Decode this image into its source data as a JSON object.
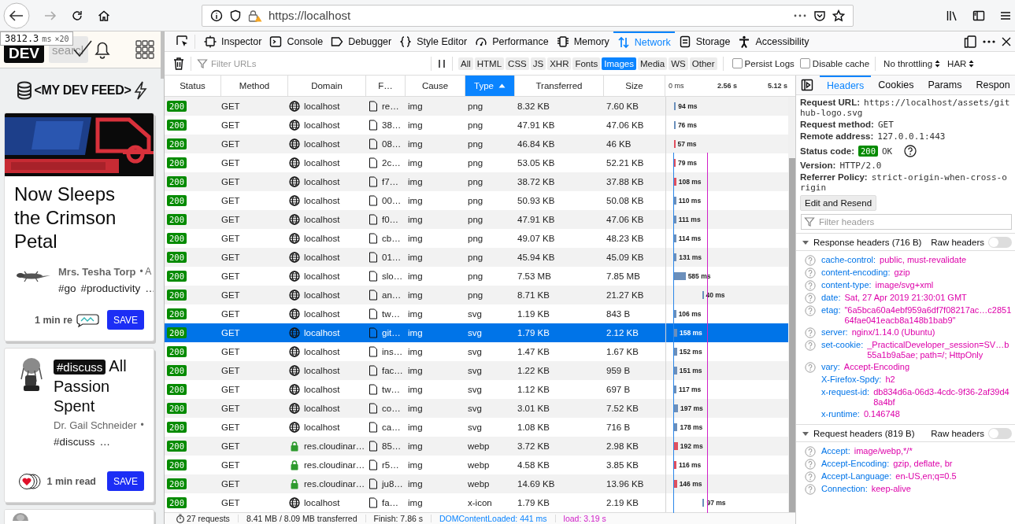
{
  "browser": {
    "url": "https://localhost"
  },
  "tooltip": {
    "value": "3812.3",
    "unit": "ms",
    "count": "×20"
  },
  "page": {
    "logo": "DEV",
    "search_placeholder": "searcl",
    "feed_title": "<MY DEV FEED>",
    "cards": [
      {
        "kind": "banner",
        "title": "Now Sleeps the Crimson Petal",
        "author": "Mrs. Tesha Torp",
        "meta": "• A",
        "tags": [
          "#go",
          "#productivity"
        ],
        "more": "…",
        "read_time": "1 min re",
        "save": "SAVE"
      },
      {
        "kind": "tagged",
        "tag": "#discuss",
        "title": "All Passion Spent",
        "author": "Dr. Gail Schneider",
        "meta": "•",
        "tags": [
          "#discuss"
        ],
        "more": "…",
        "read_time": "1 min read",
        "save": "SAVE"
      }
    ]
  },
  "devtools": {
    "tabs": [
      {
        "label": "Inspector",
        "selected": false
      },
      {
        "label": "Console",
        "selected": false
      },
      {
        "label": "Debugger",
        "selected": false
      },
      {
        "label": "Style Editor",
        "selected": false
      },
      {
        "label": "Performance",
        "selected": false
      },
      {
        "label": "Memory",
        "selected": false
      },
      {
        "label": "Network",
        "selected": true
      },
      {
        "label": "Storage",
        "selected": false
      },
      {
        "label": "Accessibility",
        "selected": false
      }
    ]
  },
  "toolbar": {
    "filter_placeholder": "Filter URLs",
    "types": [
      {
        "label": "All",
        "selected": false
      },
      {
        "label": "HTML",
        "selected": false
      },
      {
        "label": "CSS",
        "selected": false
      },
      {
        "label": "JS",
        "selected": false
      },
      {
        "label": "XHR",
        "selected": false
      },
      {
        "label": "Fonts",
        "selected": false
      },
      {
        "label": "Images",
        "selected": true
      },
      {
        "label": "Media",
        "selected": false
      },
      {
        "label": "WS",
        "selected": false
      },
      {
        "label": "Other",
        "selected": false
      }
    ],
    "persist_logs": {
      "label": "Persist Logs",
      "checked": false
    },
    "disable_cache": {
      "label": "Disable cache",
      "checked": false
    },
    "throttling": "No throttling",
    "har": "HAR"
  },
  "table": {
    "columns": [
      {
        "label": "Status",
        "sorted": false
      },
      {
        "label": "Method",
        "sorted": false
      },
      {
        "label": "Domain",
        "sorted": false
      },
      {
        "label": "F…",
        "sorted": false
      },
      {
        "label": "Cause",
        "sorted": false
      },
      {
        "label": "Type",
        "sorted": true
      },
      {
        "label": "Transferred",
        "sorted": false
      },
      {
        "label": "Size",
        "sorted": false
      }
    ],
    "waterfall_ticks": [
      "0 ms",
      "2.56 s",
      "5.12 s"
    ],
    "rows": [
      {
        "status": "200",
        "method": "GET",
        "domain": "localhost",
        "secure": false,
        "file": "re…",
        "cause": "img",
        "type": "png",
        "transferred": "8.32 KB",
        "size": "7.60 KB",
        "time": "94 ms",
        "color": "#6b8fbb",
        "late": false,
        "selected": false
      },
      {
        "status": "200",
        "method": "GET",
        "domain": "localhost",
        "secure": false,
        "file": "38…",
        "cause": "img",
        "type": "png",
        "transferred": "47.91 KB",
        "size": "47.06 KB",
        "time": "76 ms",
        "color": "#6b8fbb",
        "late": false,
        "selected": false
      },
      {
        "status": "200",
        "method": "GET",
        "domain": "localhost",
        "secure": false,
        "file": "08…",
        "cause": "img",
        "type": "png",
        "transferred": "46.84 KB",
        "size": "46 KB",
        "time": "57 ms",
        "color": "#e0505f",
        "late": false,
        "selected": false
      },
      {
        "status": "200",
        "method": "GET",
        "domain": "localhost",
        "secure": false,
        "file": "2c…",
        "cause": "img",
        "type": "png",
        "transferred": "53.05 KB",
        "size": "52.21 KB",
        "time": "79 ms",
        "color": "#e0505f",
        "late": false,
        "selected": false
      },
      {
        "status": "200",
        "method": "GET",
        "domain": "localhost",
        "secure": false,
        "file": "f7…",
        "cause": "img",
        "type": "png",
        "transferred": "38.72 KB",
        "size": "37.88 KB",
        "time": "108 ms",
        "color": "#e0505f",
        "late": false,
        "selected": false
      },
      {
        "status": "200",
        "method": "GET",
        "domain": "localhost",
        "secure": false,
        "file": "00…",
        "cause": "img",
        "type": "png",
        "transferred": "50.93 KB",
        "size": "50.08 KB",
        "time": "110 ms",
        "color": "#6b8fbb",
        "late": false,
        "selected": false
      },
      {
        "status": "200",
        "method": "GET",
        "domain": "localhost",
        "secure": false,
        "file": "f0…",
        "cause": "img",
        "type": "png",
        "transferred": "47.91 KB",
        "size": "47.06 KB",
        "time": "111 ms",
        "color": "#6b8fbb",
        "late": false,
        "selected": false
      },
      {
        "status": "200",
        "method": "GET",
        "domain": "localhost",
        "secure": false,
        "file": "cb…",
        "cause": "img",
        "type": "png",
        "transferred": "49.07 KB",
        "size": "48.23 KB",
        "time": "114 ms",
        "color": "#6b8fbb",
        "late": false,
        "selected": false
      },
      {
        "status": "200",
        "method": "GET",
        "domain": "localhost",
        "secure": false,
        "file": "01…",
        "cause": "img",
        "type": "png",
        "transferred": "45.94 KB",
        "size": "45.09 KB",
        "time": "131 ms",
        "color": "#6b8fbb",
        "late": false,
        "selected": false
      },
      {
        "status": "200",
        "method": "GET",
        "domain": "localhost",
        "secure": false,
        "file": "slo…",
        "cause": "img",
        "type": "png",
        "transferred": "7.53 MB",
        "size": "7.85 MB",
        "time": "585 ms",
        "color": "#6b8fbb",
        "late": false,
        "selected": false
      },
      {
        "status": "200",
        "method": "GET",
        "domain": "localhost",
        "secure": false,
        "file": "an…",
        "cause": "img",
        "type": "png",
        "transferred": "8.71 KB",
        "size": "21.27 KB",
        "time": "40 ms",
        "color": "#6b8fbb",
        "late": true,
        "selected": false
      },
      {
        "status": "200",
        "method": "GET",
        "domain": "localhost",
        "secure": false,
        "file": "tw…",
        "cause": "img",
        "type": "svg",
        "transferred": "1.19 KB",
        "size": "843 B",
        "time": "106 ms",
        "color": "#6b8fbb",
        "late": false,
        "selected": false
      },
      {
        "status": "200",
        "method": "GET",
        "domain": "localhost",
        "secure": false,
        "file": "git…",
        "cause": "img",
        "type": "svg",
        "transferred": "1.79 KB",
        "size": "2.12 KB",
        "time": "158 ms",
        "color": "#6b8fbb",
        "late": false,
        "selected": true
      },
      {
        "status": "200",
        "method": "GET",
        "domain": "localhost",
        "secure": false,
        "file": "ins…",
        "cause": "img",
        "type": "svg",
        "transferred": "1.47 KB",
        "size": "1.67 KB",
        "time": "152 ms",
        "color": "#6b8fbb",
        "late": false,
        "selected": false
      },
      {
        "status": "200",
        "method": "GET",
        "domain": "localhost",
        "secure": false,
        "file": "fac…",
        "cause": "img",
        "type": "svg",
        "transferred": "1.22 KB",
        "size": "959 B",
        "time": "151 ms",
        "color": "#6b8fbb",
        "late": false,
        "selected": false
      },
      {
        "status": "200",
        "method": "GET",
        "domain": "localhost",
        "secure": false,
        "file": "tw…",
        "cause": "img",
        "type": "svg",
        "transferred": "1.12 KB",
        "size": "697 B",
        "time": "117 ms",
        "color": "#6b8fbb",
        "late": false,
        "selected": false
      },
      {
        "status": "200",
        "method": "GET",
        "domain": "localhost",
        "secure": false,
        "file": "co…",
        "cause": "img",
        "type": "svg",
        "transferred": "3.01 KB",
        "size": "7.52 KB",
        "time": "197 ms",
        "color": "#6b8fbb",
        "late": false,
        "selected": false
      },
      {
        "status": "200",
        "method": "GET",
        "domain": "localhost",
        "secure": false,
        "file": "ca…",
        "cause": "img",
        "type": "svg",
        "transferred": "1.08 KB",
        "size": "716 B",
        "time": "178 ms",
        "color": "#6b8fbb",
        "late": false,
        "selected": false
      },
      {
        "status": "200",
        "method": "GET",
        "domain": "res.cloudinar…",
        "secure": true,
        "file": "85…",
        "cause": "img",
        "type": "webp",
        "transferred": "3.72 KB",
        "size": "2.98 KB",
        "time": "192 ms",
        "color": "#e0505f",
        "late": false,
        "selected": false
      },
      {
        "status": "200",
        "method": "GET",
        "domain": "res.cloudinar…",
        "secure": true,
        "file": "r5…",
        "cause": "img",
        "type": "webp",
        "transferred": "4.58 KB",
        "size": "3.85 KB",
        "time": "116 ms",
        "color": "#e0505f",
        "late": false,
        "selected": false
      },
      {
        "status": "200",
        "method": "GET",
        "domain": "res.cloudinar…",
        "secure": true,
        "file": "ju8…",
        "cause": "img",
        "type": "webp",
        "transferred": "14.69 KB",
        "size": "13.96 KB",
        "time": "146 ms",
        "color": "#e0505f",
        "late": false,
        "selected": false
      },
      {
        "status": "200",
        "method": "GET",
        "domain": "localhost",
        "secure": false,
        "file": "fa…",
        "cause": "img",
        "type": "x-icon",
        "transferred": "1.79 KB",
        "size": "2.19 KB",
        "time": "97 ms",
        "color": "#6b8fbb",
        "late": true,
        "selected": false
      }
    ]
  },
  "status_bar": {
    "requests": "27 requests",
    "transferred": "8.41 MB / 8.09 MB transferred",
    "finish": "Finish: 7.86 s",
    "dom_loaded": "DOMContentLoaded: 441 ms",
    "load": "load: 3.19 s"
  },
  "details": {
    "tabs": [
      {
        "label": "Headers",
        "selected": true
      },
      {
        "label": "Cookies",
        "selected": false
      },
      {
        "label": "Params",
        "selected": false
      },
      {
        "label": "Respon",
        "selected": false
      }
    ],
    "summary": [
      {
        "kind": "text",
        "label": "Request URL:",
        "value": "https://localhost/assets/github-logo.svg"
      },
      {
        "kind": "text",
        "label": "Request method:",
        "value": "GET"
      },
      {
        "kind": "text",
        "label": "Remote address:",
        "value": "127.0.0.1:443"
      },
      {
        "kind": "status",
        "label": "Status code:",
        "badge": "200",
        "value": "OK"
      },
      {
        "kind": "text",
        "label": "Version:",
        "value": "HTTP/2.0"
      },
      {
        "kind": "text",
        "label": "Referrer Policy:",
        "value": "strict-origin-when-cross-origin"
      }
    ],
    "edit_button": "Edit and Resend",
    "filter_placeholder": "Filter headers",
    "sections": [
      {
        "title": "Response headers (716 B)",
        "expanded": true,
        "raw_label": "Raw headers",
        "raw_on": false,
        "headers": [
          {
            "name": "cache-control:",
            "value": "public, must-revalidate",
            "help": true
          },
          {
            "name": "content-encoding:",
            "value": "gzip",
            "help": true
          },
          {
            "name": "content-type:",
            "value": "image/svg+xml",
            "help": true
          },
          {
            "name": "date:",
            "value": "Sat, 27 Apr 2019 21:30:01 GMT",
            "help": true
          },
          {
            "name": "etag:",
            "value": "\"6a5bca60a4ebf959a6df7f08217ac…c285164fae041eacb8a148b1bab9\"",
            "help": true
          },
          {
            "name": "server:",
            "value": "nginx/1.14.0 (Ubuntu)",
            "help": true
          },
          {
            "name": "set-cookie:",
            "value": "_PracticalDeveloper_session=SV…b55a1b9a5ae; path=/; HttpOnly",
            "help": true
          },
          {
            "name": "vary:",
            "value": "Accept-Encoding",
            "help": true
          },
          {
            "name": "X-Firefox-Spdy:",
            "value": "h2",
            "help": false
          },
          {
            "name": "x-request-id:",
            "value": "db834d6a-06d3-4cdc-9f36-2af39d48a4bf",
            "help": false
          },
          {
            "name": "x-runtime:",
            "value": "0.146748",
            "help": false
          }
        ]
      },
      {
        "title": "Request headers (819 B)",
        "expanded": true,
        "raw_label": "Raw headers",
        "raw_on": false,
        "headers": [
          {
            "name": "Accept:",
            "value": "image/webp,*/*",
            "help": true
          },
          {
            "name": "Accept-Encoding:",
            "value": "gzip, deflate, br",
            "help": true
          },
          {
            "name": "Accept-Language:",
            "value": "en-US,en;q=0.5",
            "help": true
          },
          {
            "name": "Connection:",
            "value": "keep-alive",
            "help": true
          }
        ]
      }
    ]
  }
}
